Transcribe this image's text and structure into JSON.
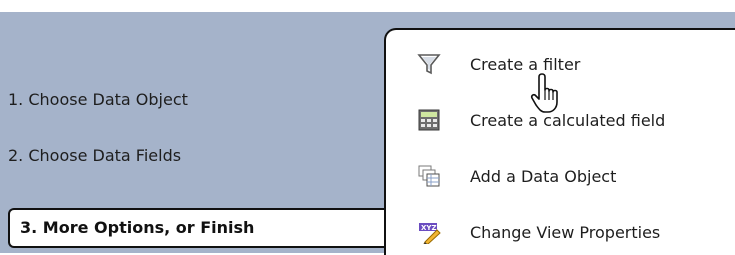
{
  "steps": {
    "step1": "1. Choose Data Object",
    "step2": "2. Choose Data Fields",
    "step3": "3. More Options, or Finish"
  },
  "options": {
    "create_filter": "Create a filter",
    "create_calculated_field": "Create a calculated field",
    "add_data_object": "Add a Data Object",
    "change_view_properties": "Change View Properties"
  },
  "colors": {
    "panel_bg": "#a5b3ca",
    "active_bg": "#ffffff",
    "text": "#1e1e1e"
  },
  "icons": {
    "filter": "filter-funnel-icon",
    "calculator": "calculator-icon",
    "add_object": "add-data-object-icon",
    "view_properties": "view-properties-icon",
    "cursor": "hand-pointer-cursor-icon"
  }
}
